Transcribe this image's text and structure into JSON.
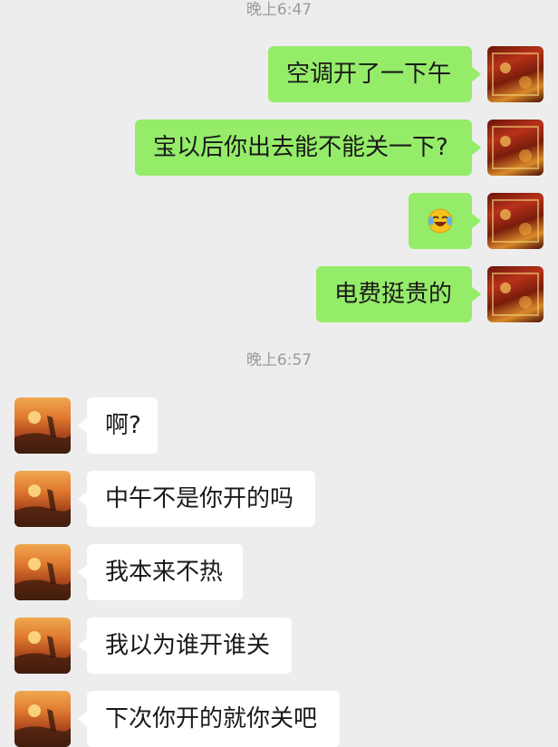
{
  "chat": {
    "timestamps": [
      "晚上6:47",
      "晚上6:57"
    ],
    "sent": [
      {
        "text": "空调开了一下午"
      },
      {
        "text": "宝以后你出去能不能关一下?"
      },
      {
        "text": "",
        "emoji": "laughing-crying-emoji"
      },
      {
        "text": "电费挺贵的"
      }
    ],
    "received": [
      {
        "text": "啊?"
      },
      {
        "text": "中午不是你开的吗"
      },
      {
        "text": "我本来不热"
      },
      {
        "text": "我以为谁开谁关"
      },
      {
        "text": "下次你开的就你关吧"
      }
    ]
  },
  "colors": {
    "background": "#ededed",
    "sent_bubble": "#95ec69",
    "received_bubble": "#ffffff",
    "timestamp_text": "#9a9a9a"
  }
}
